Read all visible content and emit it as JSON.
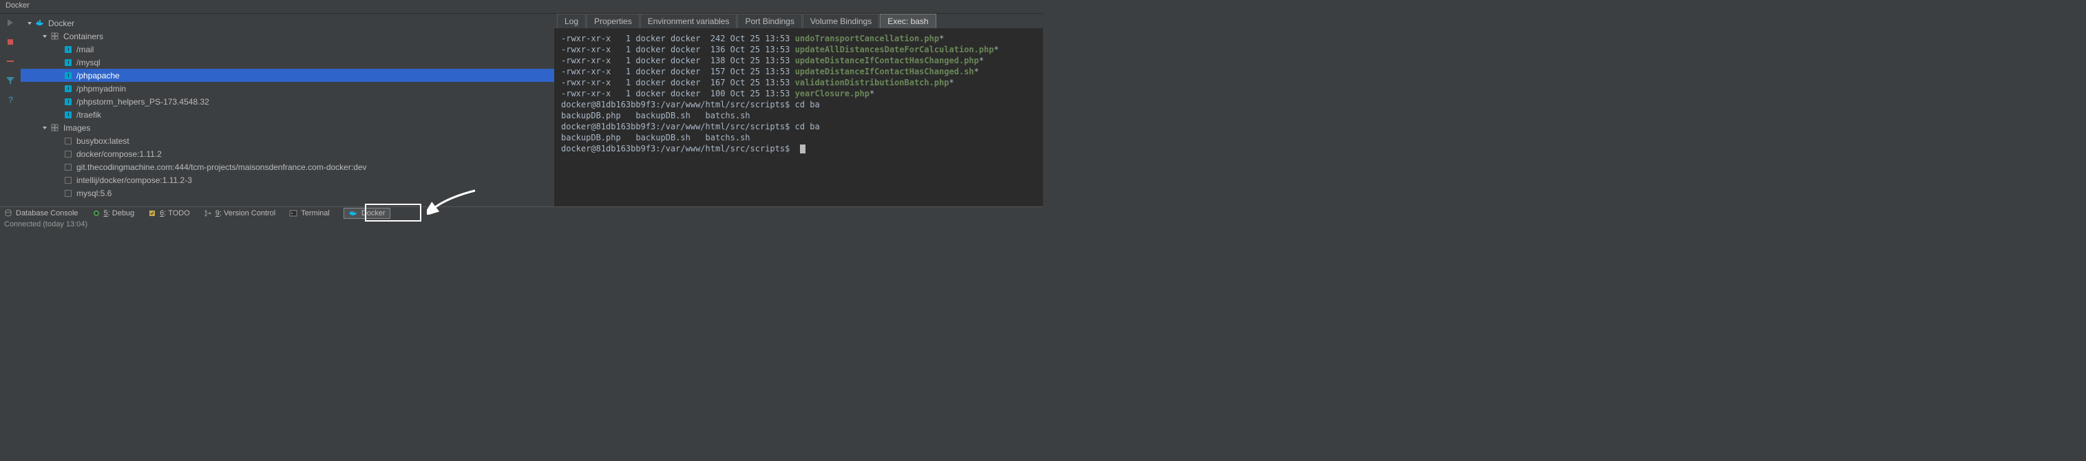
{
  "title": "Docker",
  "tree": {
    "root": "Docker",
    "containers_label": "Containers",
    "containers": [
      "/mail",
      "/mysql",
      "/phpapache",
      "/phpmyadmin",
      "/phpstorm_helpers_PS-173.4548.32",
      "/traefik"
    ],
    "selected_container": "/phpapache",
    "images_label": "Images",
    "images": [
      "busybox:latest",
      "docker/compose:1.11.2",
      "git.thecodingmachine.com:444/tcm-projects/maisonsdenfrance.com-docker:dev",
      "intellij/docker/compose:1.11.2-3",
      "mysql:5.6"
    ]
  },
  "tabs": {
    "items": [
      "Log",
      "Properties",
      "Environment variables",
      "Port Bindings",
      "Volume Bindings",
      "Exec: bash"
    ],
    "active": "Exec: bash"
  },
  "terminal": {
    "ls_lines": [
      {
        "perm": "-rwxr-xr-x",
        "n": "1",
        "u": "docker",
        "g": "docker",
        "size": "242",
        "date": "Oct 25 13:53",
        "name": "undoTransportCancellation.php"
      },
      {
        "perm": "-rwxr-xr-x",
        "n": "1",
        "u": "docker",
        "g": "docker",
        "size": "136",
        "date": "Oct 25 13:53",
        "name": "updateAllDistancesDateForCalculation.php"
      },
      {
        "perm": "-rwxr-xr-x",
        "n": "1",
        "u": "docker",
        "g": "docker",
        "size": "138",
        "date": "Oct 25 13:53",
        "name": "updateDistanceIfContactHasChanged.php"
      },
      {
        "perm": "-rwxr-xr-x",
        "n": "1",
        "u": "docker",
        "g": "docker",
        "size": "157",
        "date": "Oct 25 13:53",
        "name": "updateDistanceIfContactHasChanged.sh"
      },
      {
        "perm": "-rwxr-xr-x",
        "n": "1",
        "u": "docker",
        "g": "docker",
        "size": "167",
        "date": "Oct 25 13:53",
        "name": "validationDistributionBatch.php"
      },
      {
        "perm": "-rwxr-xr-x",
        "n": "1",
        "u": "docker",
        "g": "docker",
        "size": "100",
        "date": "Oct 25 13:53",
        "name": "yearClosure.php"
      }
    ],
    "prompt": "docker@81db163bb9f3:/var/www/html/src/scripts$",
    "cmd1": "cd ba",
    "completion": "backupDB.php   backupDB.sh   batchs.sh",
    "cmd2": "cd ba"
  },
  "bottom": {
    "db": "Database Console",
    "debug_num": "5",
    "debug_label": ": Debug",
    "todo_num": "6",
    "todo_label": ": TODO",
    "vcs_num": "9",
    "vcs_label": ": Version Control",
    "terminal": "Terminal",
    "docker": "Docker"
  },
  "status": "Connected (today 13:04)"
}
